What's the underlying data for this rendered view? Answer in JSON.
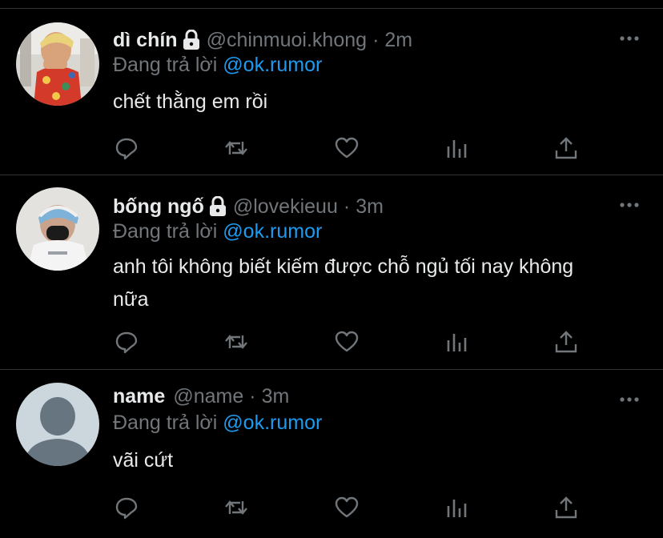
{
  "tweets": [
    {
      "display_name": "dì chín",
      "locked": true,
      "handle": "@chinmuoi.khong",
      "separator": "·",
      "time": "2m",
      "replying_prefix": "Đang trả lời",
      "replying_to": "@ok.rumor",
      "text": "chết thằng em rồi",
      "avatar": "photo-person-red-floral"
    },
    {
      "display_name": "bống ngố",
      "locked": true,
      "handle": "@lovekieuu",
      "separator": "·",
      "time": "3m",
      "replying_prefix": "Đang trả lời",
      "replying_to": "@ok.rumor",
      "text": "anh tôi không biết kiếm được chỗ ngủ tối nay không nữa",
      "avatar": "photo-person-masked"
    },
    {
      "display_name": "name",
      "locked": false,
      "handle": "@name",
      "separator": "·",
      "time": "3m",
      "replying_prefix": "Đang trả lời",
      "replying_to": "@ok.rumor",
      "text": "vãi cứt",
      "avatar": "default-avatar"
    }
  ],
  "actions": [
    "reply-icon",
    "retweet-icon",
    "like-icon",
    "analytics-icon",
    "share-icon"
  ],
  "colors": {
    "background": "#000000",
    "text": "#e7e9ea",
    "muted": "#71767b",
    "accent": "#1d9bf0",
    "divider": "#2f3336"
  }
}
